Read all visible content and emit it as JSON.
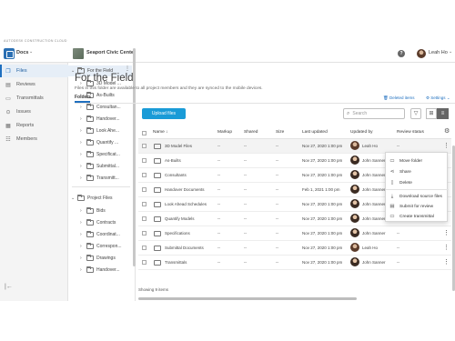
{
  "brand_line": "AUTODESK CONSTRUCTION CLOUD",
  "header": {
    "module": "Docs",
    "project": "Seaport Civic Center",
    "user_name": "Leah Ho",
    "help": "?"
  },
  "rail": {
    "items": [
      {
        "label": "Files",
        "icon": "folder-icon",
        "glyph": "❐"
      },
      {
        "label": "Reviews",
        "icon": "review-icon",
        "glyph": "▤"
      },
      {
        "label": "Transmittals",
        "icon": "transmittal-icon",
        "glyph": "▭"
      },
      {
        "label": "Issues",
        "icon": "issue-icon",
        "glyph": "⊙"
      },
      {
        "label": "Reports",
        "icon": "report-icon",
        "glyph": "▦"
      },
      {
        "label": "Members",
        "icon": "members-icon",
        "glyph": "☷"
      }
    ],
    "collapse": "|←"
  },
  "tree": {
    "field": "For the Field",
    "field_children": [
      "3D Model ...",
      "As-Builts",
      "Consultan...",
      "Handover...",
      "Look Ahe...",
      "Quantify ...",
      "Specificat...",
      "Submittal...",
      "Transmitt..."
    ],
    "project": "Project Files",
    "project_children": [
      "Bids",
      "Contracts",
      "Coordinat...",
      "Correspon...",
      "Drawings",
      "Handover..."
    ]
  },
  "main": {
    "title": "For the Field",
    "subtitle": "Files in this folder are available to all project members and they are synced to the mobile devices.",
    "tab": "Folders",
    "deleted_items": "Deleted items",
    "settings": "Settings",
    "upload": "Upload files",
    "search_placeholder": "Search",
    "footer": "Showing 9 items"
  },
  "columns": [
    "Name",
    "Markup",
    "Shared",
    "Size",
    "Last updated",
    "Updated by",
    "Review status"
  ],
  "rows": [
    {
      "name": "3D Model Files",
      "markup": "--",
      "shared": "--",
      "size": "--",
      "updated": "Nov 27, 2020 1:00 pm",
      "by": "Leah Ho",
      "review": "--"
    },
    {
      "name": "As-Builts",
      "markup": "--",
      "shared": "--",
      "size": "--",
      "updated": "Nov 27, 2020 1:00 pm",
      "by": "John Sanner",
      "review": "--"
    },
    {
      "name": "Consultants",
      "markup": "--",
      "shared": "--",
      "size": "--",
      "updated": "Nov 27, 2020 1:00 pm",
      "by": "John Sanner",
      "review": "--"
    },
    {
      "name": "Handover Documents",
      "markup": "--",
      "shared": "--",
      "size": "--",
      "updated": "Feb 1, 2021 1:00 pm",
      "by": "John Sanner",
      "review": "--"
    },
    {
      "name": "Look Ahead Schedules",
      "markup": "--",
      "shared": "--",
      "size": "--",
      "updated": "Nov 27, 2020 1:00 pm",
      "by": "John Sanner",
      "review": "--"
    },
    {
      "name": "Quantify Models",
      "markup": "--",
      "shared": "--",
      "size": "--",
      "updated": "Nov 27, 2020 1:00 pm",
      "by": "John Sanner",
      "review": "--"
    },
    {
      "name": "Specifications",
      "markup": "--",
      "shared": "--",
      "size": "--",
      "updated": "Nov 27, 2020 1:00 pm",
      "by": "John Sanner",
      "review": "--"
    },
    {
      "name": "Submittal Documents",
      "markup": "--",
      "shared": "--",
      "size": "--",
      "updated": "Nov 27, 2020 1:00 pm",
      "by": "Leah Ho",
      "review": "--"
    },
    {
      "name": "Transmittals",
      "markup": "--",
      "shared": "--",
      "size": "--",
      "updated": "Nov 27, 2020 1:00 pm",
      "by": "John Sanner",
      "review": "--"
    }
  ],
  "context_menu": [
    {
      "label": "Move folder",
      "icon": "move-icon",
      "glyph": "▭"
    },
    {
      "label": "Share",
      "icon": "share-icon",
      "glyph": "⋖"
    },
    {
      "label": "Delete",
      "icon": "delete-icon",
      "glyph": "▯"
    },
    {
      "label": "Download source files",
      "icon": "download-icon",
      "glyph": "⤓"
    },
    {
      "label": "Submit for review",
      "icon": "submit-icon",
      "glyph": "▤"
    },
    {
      "label": "Create transmittal",
      "icon": "transmittal-icon",
      "glyph": "▭"
    }
  ],
  "colors": {
    "accent": "#1f6fbf",
    "upload": "#1a9bd7"
  }
}
